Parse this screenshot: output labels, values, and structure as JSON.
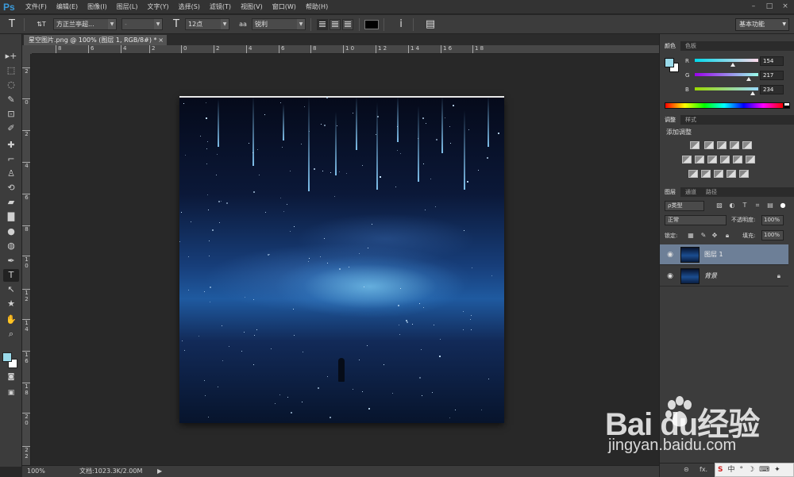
{
  "app": {
    "logo": "Ps",
    "menu": [
      "文件(F)",
      "编辑(E)",
      "图像(I)",
      "图层(L)",
      "文字(Y)",
      "选择(S)",
      "滤镜(T)",
      "视图(V)",
      "窗口(W)",
      "帮助(H)"
    ],
    "window_controls": [
      "–",
      "□",
      "×"
    ]
  },
  "options": {
    "tool_icon": "T",
    "orientation_icon": "⇅T",
    "font_family": "方正兰亭超...",
    "font_style": "-",
    "size_icon": "T",
    "font_size": "12点",
    "aa_icon": "aa",
    "anti_alias": "锐利",
    "text_color": "#000000",
    "warp_icon": "ⅰ",
    "panel_icon": "▤",
    "workspace": "基本功能"
  },
  "document": {
    "tab_title": "星空图片.png @ 100% (图层 1, RGB/8#) *",
    "close": "×"
  },
  "rulers": {
    "top": [
      "8",
      "6",
      "4",
      "2",
      "0",
      "2",
      "4",
      "6",
      "8",
      "1 0",
      "1 2",
      "1 4",
      "1 6",
      "1 8"
    ],
    "left": [
      "2",
      "0",
      "2",
      "4",
      "6",
      "8",
      "1 0",
      "1 2",
      "1 4",
      "1 6",
      "1 8",
      "2 0",
      "2 2"
    ]
  },
  "tools": [
    "▸+",
    "⬚",
    "◌",
    "✎",
    "⊡",
    "✐",
    "✚",
    "⌐",
    "♙",
    "⟲",
    "▰",
    "▇",
    "●",
    "◍",
    "✒",
    "T",
    "↖",
    "★",
    "✋",
    "⌕"
  ],
  "colors": {
    "foreground": "#9adaea",
    "background": "#ffffff"
  },
  "color_panel": {
    "tabs": [
      "颜色",
      "色板"
    ],
    "r_label": "R",
    "r_value": "154",
    "g_label": "G",
    "g_value": "217",
    "b_label": "B",
    "b_value": "234"
  },
  "adjust_panel": {
    "tabs": [
      "调整",
      "样式"
    ],
    "title": "添加调整"
  },
  "layers_panel": {
    "tabs": [
      "图层",
      "通道",
      "路径"
    ],
    "filter": "ρ类型",
    "blend_mode": "正常",
    "opacity_label": "不透明度:",
    "opacity": "100%",
    "lock_label": "锁定:",
    "fill_label": "填充:",
    "fill": "100%",
    "layers": [
      {
        "name": "图层 1",
        "selected": true
      },
      {
        "name": "背景",
        "selected": false,
        "locked": true
      }
    ],
    "footer_icons": [
      "⊝",
      "fx."
    ]
  },
  "status": {
    "zoom": "100%",
    "doc_info": "文档:1023.3K/2.00M",
    "arrow": "▶"
  },
  "watermark": {
    "main": "Bai  du经验",
    "sub": "jingyan.baidu.com"
  },
  "ime": [
    "S",
    "中",
    "°",
    "☽",
    "⌨",
    "✦"
  ]
}
